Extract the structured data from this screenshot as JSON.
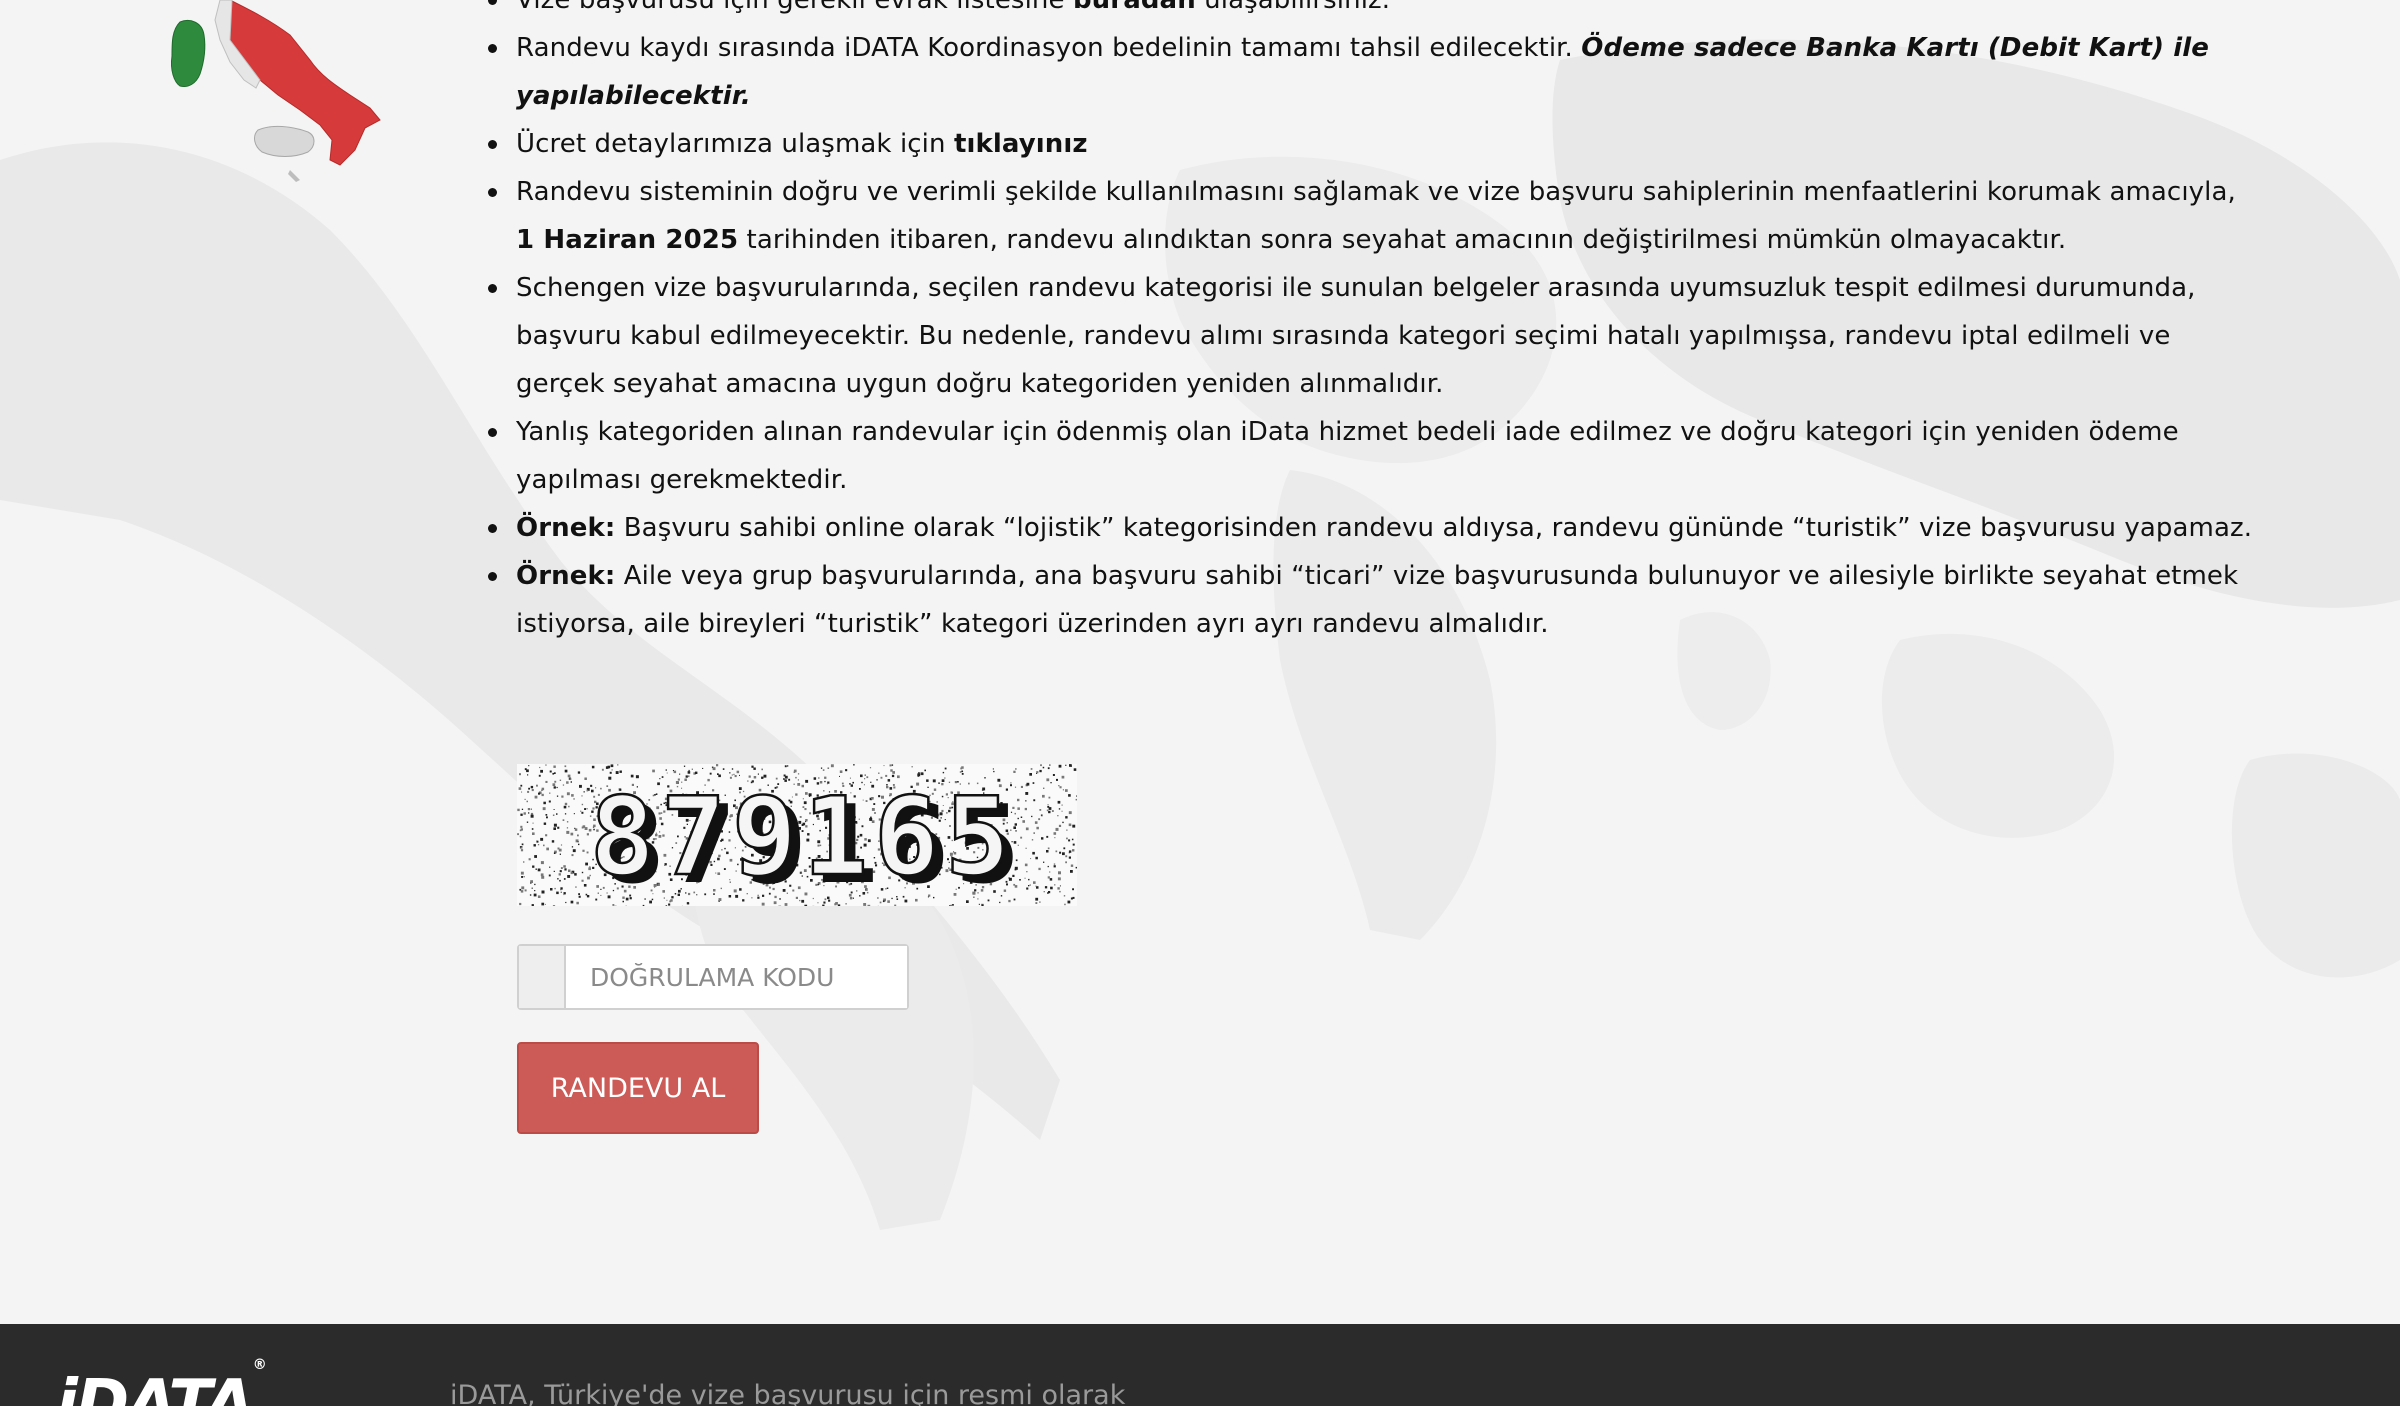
{
  "notes": [
    {
      "parts": [
        {
          "text": "Vize başvurusu için gerekli evrak listesine ",
          "style": "normal"
        },
        {
          "text": "buradan",
          "style": "bold",
          "link": true
        },
        {
          "text": " ulaşabilirsiniz.",
          "style": "normal"
        }
      ]
    },
    {
      "parts": [
        {
          "text": "Randevu kaydı sırasında iDATA Koordinasyon bedelinin tamamı tahsil edilecektir. ",
          "style": "normal"
        },
        {
          "text": "Ödeme sadece Banka Kartı (Debit Kart) ile yapılabilecektir.",
          "style": "bold-italic"
        }
      ]
    },
    {
      "parts": [
        {
          "text": "Ücret detaylarımıza ulaşmak için ",
          "style": "normal"
        },
        {
          "text": "tıklayınız",
          "style": "bold",
          "link": true
        }
      ]
    },
    {
      "parts": [
        {
          "text": "Randevu sisteminin doğru ve verimli şekilde kullanılmasını sağlamak ve vize başvuru sahiplerinin menfaatlerini korumak amacıyla, ",
          "style": "normal"
        },
        {
          "text": "1 Haziran 2025",
          "style": "bold"
        },
        {
          "text": " tarihinden itibaren, randevu alındıktan sonra seyahat amacının değiştirilmesi mümkün olmayacaktır.",
          "style": "normal"
        }
      ]
    },
    {
      "parts": [
        {
          "text": "Schengen vize başvurularında, seçilen randevu kategorisi ile sunulan belgeler arasında uyumsuzluk tespit edilmesi durumunda, başvuru kabul edilmeyecektir. Bu nedenle, randevu alımı sırasında kategori seçimi hatalı yapılmışsa, randevu iptal edilmeli ve gerçek seyahat amacına uygun doğru kategoriden yeniden alınmalıdır.",
          "style": "normal"
        }
      ]
    },
    {
      "parts": [
        {
          "text": "Yanlış kategoriden alınan randevular için ödenmiş olan iData hizmet bedeli iade edilmez ve doğru kategori için yeniden ödeme yapılması gerekmektedir.",
          "style": "normal"
        }
      ]
    },
    {
      "parts": [
        {
          "text": "Örnek:",
          "style": "bold"
        },
        {
          "text": " Başvuru sahibi online olarak “lojistik” kategorisinden randevu aldıysa, randevu gününde “turistik” vize başvurusu yapamaz.",
          "style": "normal"
        }
      ]
    },
    {
      "parts": [
        {
          "text": "Örnek:",
          "style": "bold"
        },
        {
          "text": " Aile veya grup başvurularında, ana başvuru sahibi “ticari” vize başvurusunda bulunuyor ve ailesiyle birlikte seyahat etmek istiyorsa, aile bireyleri “turistik” kategori üzerinden ayrı ayrı randevu almalıdır.",
          "style": "normal"
        }
      ]
    }
  ],
  "captcha": {
    "code": "879165"
  },
  "form": {
    "code_placeholder": "DOĞRULAMA KODU",
    "code_value": "",
    "submit_label": "RANDEVU AL"
  },
  "footer": {
    "logo_text": "iDATA",
    "logo_mark": "®",
    "text": "iDATA, Türkiye'de vize başvurusu için resmi olarak"
  },
  "colors": {
    "primary_button": "#cc5b57",
    "footer_bg": "#2b2b2b",
    "flag_green": "#2e8b3e",
    "flag_red": "#d63a3a"
  }
}
